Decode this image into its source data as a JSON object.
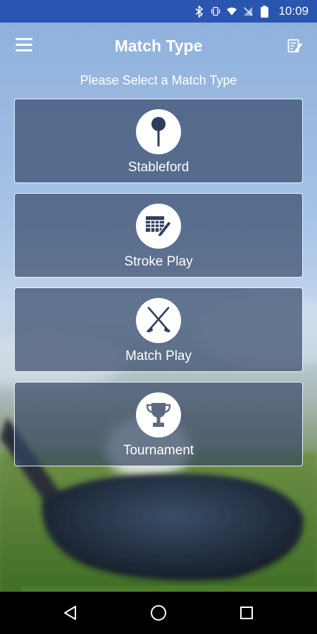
{
  "status_bar": {
    "time": "10:09",
    "icons": [
      "bluetooth-icon",
      "vibrate-icon",
      "wifi-icon",
      "no-sim-icon",
      "battery-icon"
    ]
  },
  "header": {
    "title": "Match Type",
    "menu_icon": "hamburger-menu-icon",
    "edit_icon": "edit-note-icon"
  },
  "subtitle": "Please Select a Match Type",
  "match_types": [
    {
      "label": "Stableford",
      "icon": "golf-tee-icon"
    },
    {
      "label": "Stroke Play",
      "icon": "scorecard-pencil-icon"
    },
    {
      "label": "Match Play",
      "icon": "crossed-clubs-icon"
    },
    {
      "label": "Tournament",
      "icon": "trophy-icon"
    }
  ],
  "nav_bar": {
    "icons": [
      "back-icon",
      "home-icon",
      "recents-icon"
    ]
  },
  "colors": {
    "status_bar": "#2a55b0",
    "card_fill": "#344664",
    "icon_dark": "#2e3f5c"
  }
}
